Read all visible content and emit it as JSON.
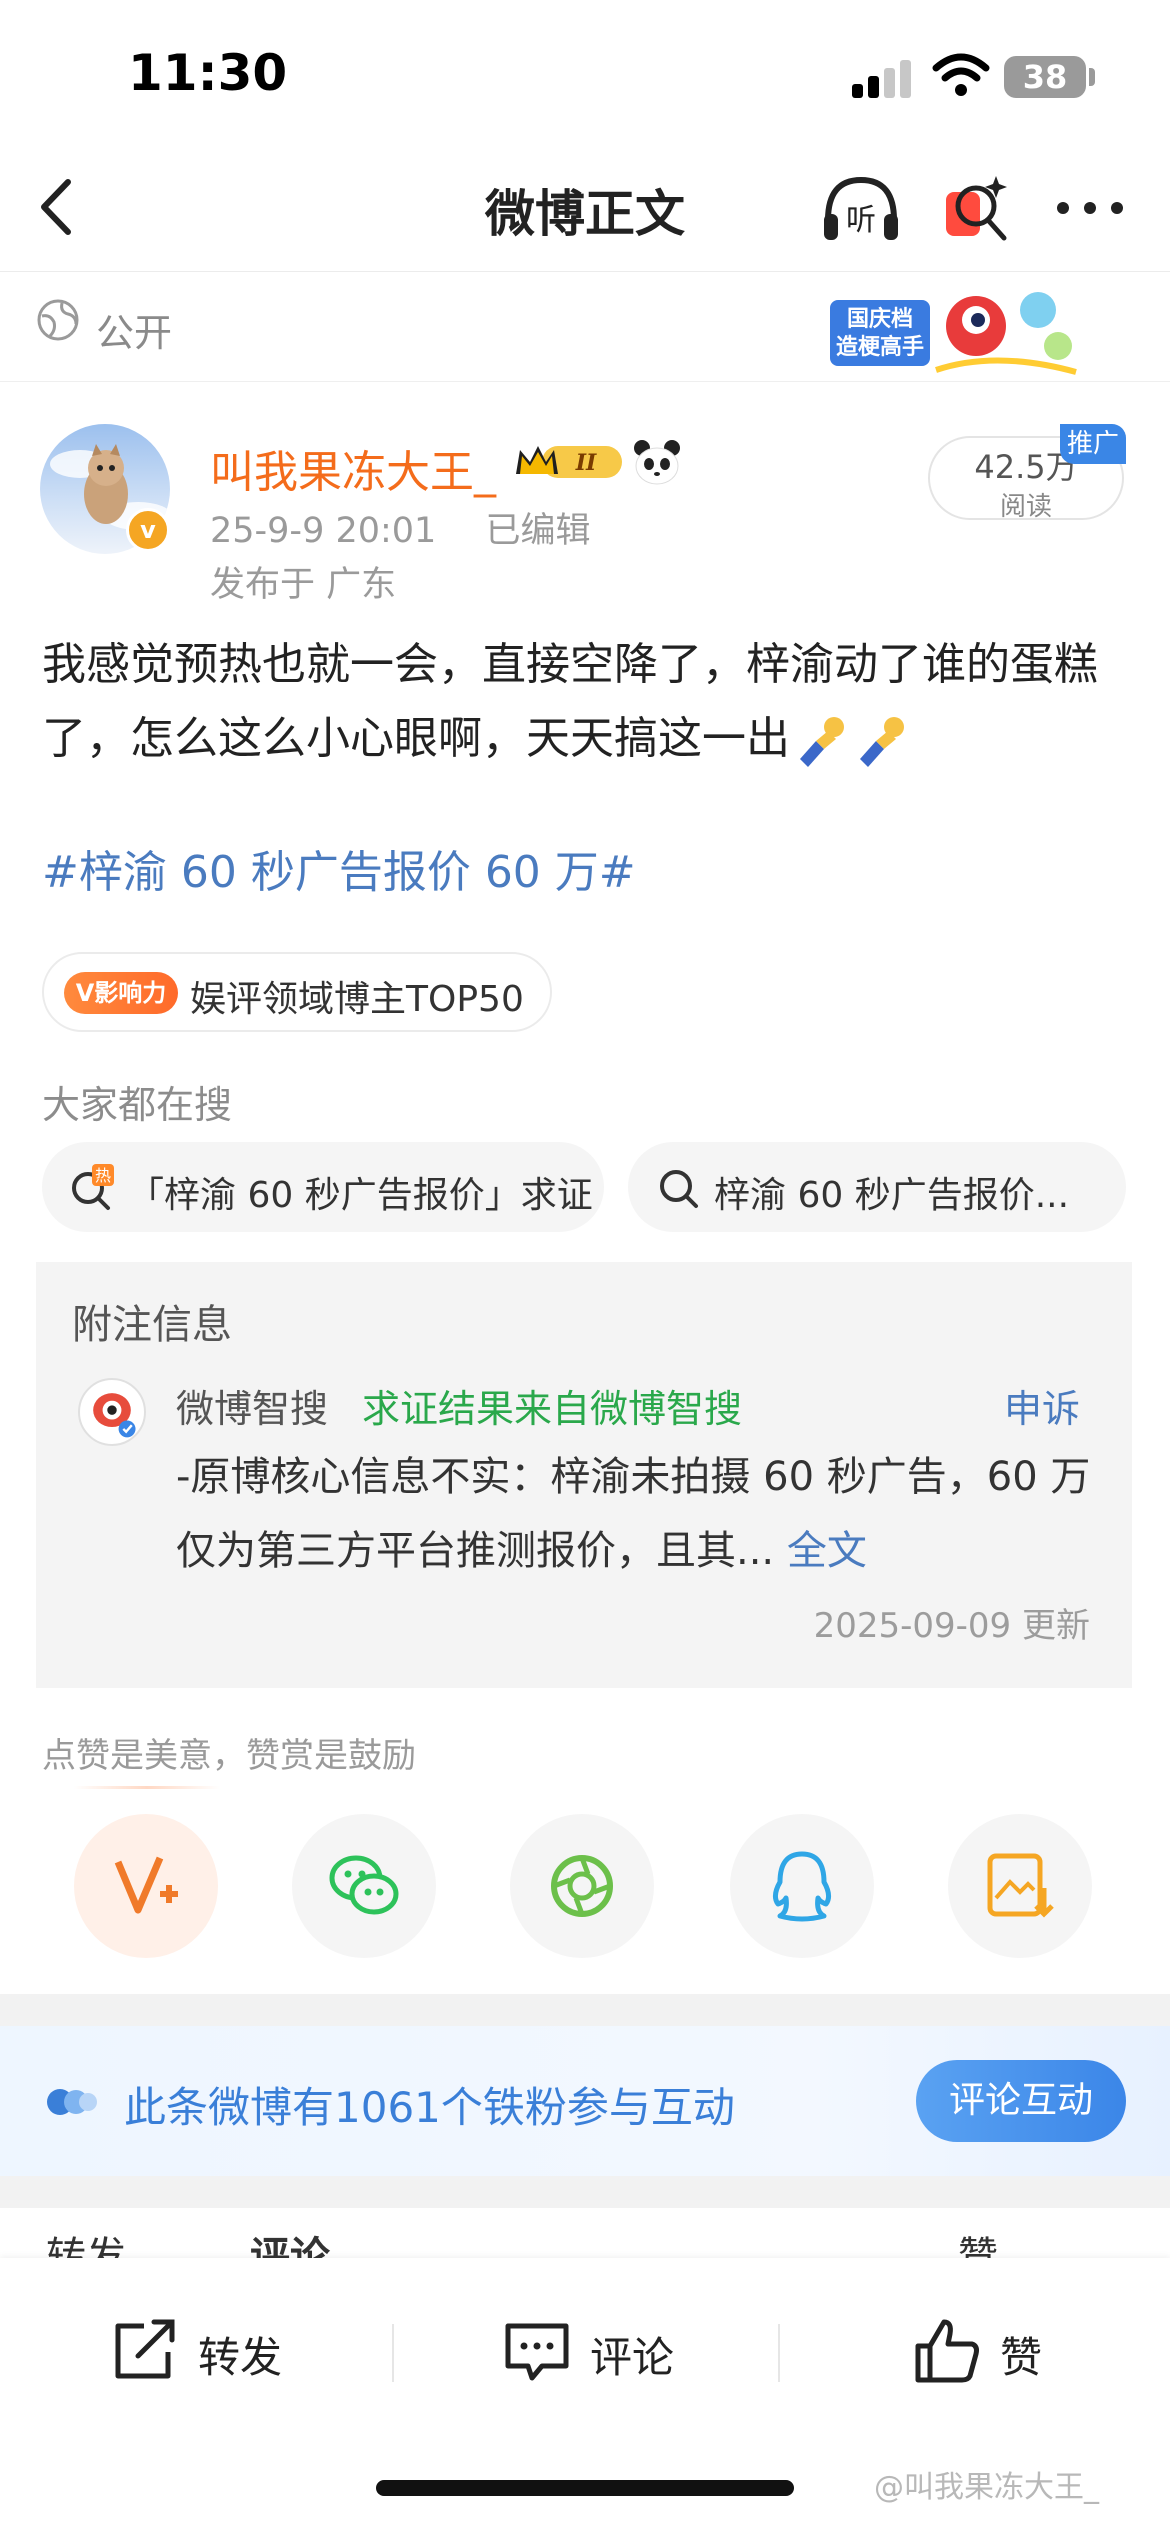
{
  "status_bar": {
    "time": "11:30",
    "battery": "38"
  },
  "nav": {
    "title": "微博正文",
    "listen_label": "听"
  },
  "visibility": {
    "label": "公开",
    "promo_banner_line1": "国庆档",
    "promo_banner_line2": "造梗高手"
  },
  "post": {
    "username": "叫我果冻大王_",
    "crown_level": "II",
    "verified_badge": "v",
    "date": "25-9-9 20:01",
    "edited": "已编辑",
    "location": "发布于 广东",
    "read_count": "42.5万",
    "read_label": "阅读",
    "promo_tag": "推广",
    "text": "我感觉预热也就一会，直接空降了，梓渝动了谁的蛋糕了，怎么这么小心眼啊，天天搞这一出",
    "hashtag": "#梓渝 60 秒广告报价 60 万#"
  },
  "influence": {
    "tag": "V影响力",
    "text": "娱评领域博主TOP50"
  },
  "search": {
    "title": "大家都在搜",
    "chips": [
      {
        "hot_mark": "热",
        "text": "「梓渝 60 秒广告报价」求证"
      },
      {
        "text": "梓渝 60 秒广告报价..."
      }
    ]
  },
  "note": {
    "title": "附注信息",
    "ai_name": "微博智搜",
    "ai_source": "求证结果来自微博智搜",
    "appeal": "申诉",
    "body": "-原博核心信息不实：梓渝未拍摄 60 秒广告，60 万仅为第三方平台推测报价，且其...",
    "full_text": "全文",
    "date": "2025-09-09 更新"
  },
  "like_hint": "点赞是美意，赞赏是鼓励",
  "share_icons": [
    "v-plus-icon",
    "wechat-icon",
    "moments-icon",
    "qq-icon",
    "save-image-icon"
  ],
  "colors": {
    "orange_username": "#f46c1b",
    "link_blue": "#4a7bbf",
    "green_source": "#2aa84b",
    "fans_blue": "#3a7fd8"
  },
  "fans": {
    "text": "此条微博有1061个铁粉参与互动",
    "button": "评论互动"
  },
  "peek": {
    "left": "转发",
    "mid": "评论",
    "right": "赞"
  },
  "toolbar": {
    "forward": "转发",
    "comment": "评论",
    "like": "赞"
  },
  "watermark": "@叫我果冻大王_"
}
